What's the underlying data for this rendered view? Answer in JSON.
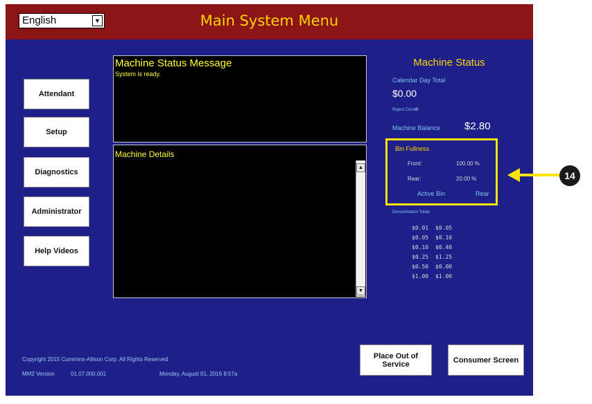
{
  "header": {
    "title": "Main System Menu",
    "language": "English"
  },
  "nav": {
    "buttons": [
      {
        "label": "Attendant"
      },
      {
        "label": "Setup"
      },
      {
        "label": "Diagnostics"
      },
      {
        "label": "Administrator"
      },
      {
        "label": "Help Videos"
      }
    ]
  },
  "status_message": {
    "title": "Machine Status Message",
    "text": "System is ready."
  },
  "details": {
    "title": "Machine Details"
  },
  "machine_status": {
    "heading": "Machine Status",
    "calendar_day_total_label": "Calendar Day Total",
    "calendar_day_total": "$0.00",
    "reject_count_label": "Reject Count",
    "reject_count": "0",
    "machine_balance_label": "Machine Balance",
    "machine_balance": "$2.80",
    "bin_fullness": {
      "label": "Bin Fullness",
      "front_label": "Front:",
      "front_value": "100.00 %",
      "rear_label": "Rear:",
      "rear_value": "20.00 %",
      "active_bin_label": "Active Bin",
      "active_bin": "Rear"
    },
    "denomination_totals_label": "Denomination Totals",
    "denominations": [
      {
        "denom": "$0.01",
        "total": "$0.05"
      },
      {
        "denom": "$0.05",
        "total": "$0.10"
      },
      {
        "denom": "$0.10",
        "total": "$0.40"
      },
      {
        "denom": "$0.25",
        "total": "$1.25"
      },
      {
        "denom": "$0.50",
        "total": "$0.00"
      },
      {
        "denom": "$1.00",
        "total": "$1.00"
      }
    ]
  },
  "footer": {
    "copyright": "Copyright 2015 Cummins-Allison Corp. All Rights Reserved",
    "version_label": "MM2 Version",
    "version": "01.07.000.001",
    "datetime": "Monday, August 01, 2016 8:57a"
  },
  "actions": {
    "out_of_service": "Place Out of Service",
    "consumer_screen": "Consumer Screen"
  },
  "callout": {
    "number": "14"
  },
  "colors": {
    "background": "#1f1f8a",
    "titlebar": "#8b1414",
    "accent": "#ffd400",
    "highlight": "#ffe600"
  }
}
